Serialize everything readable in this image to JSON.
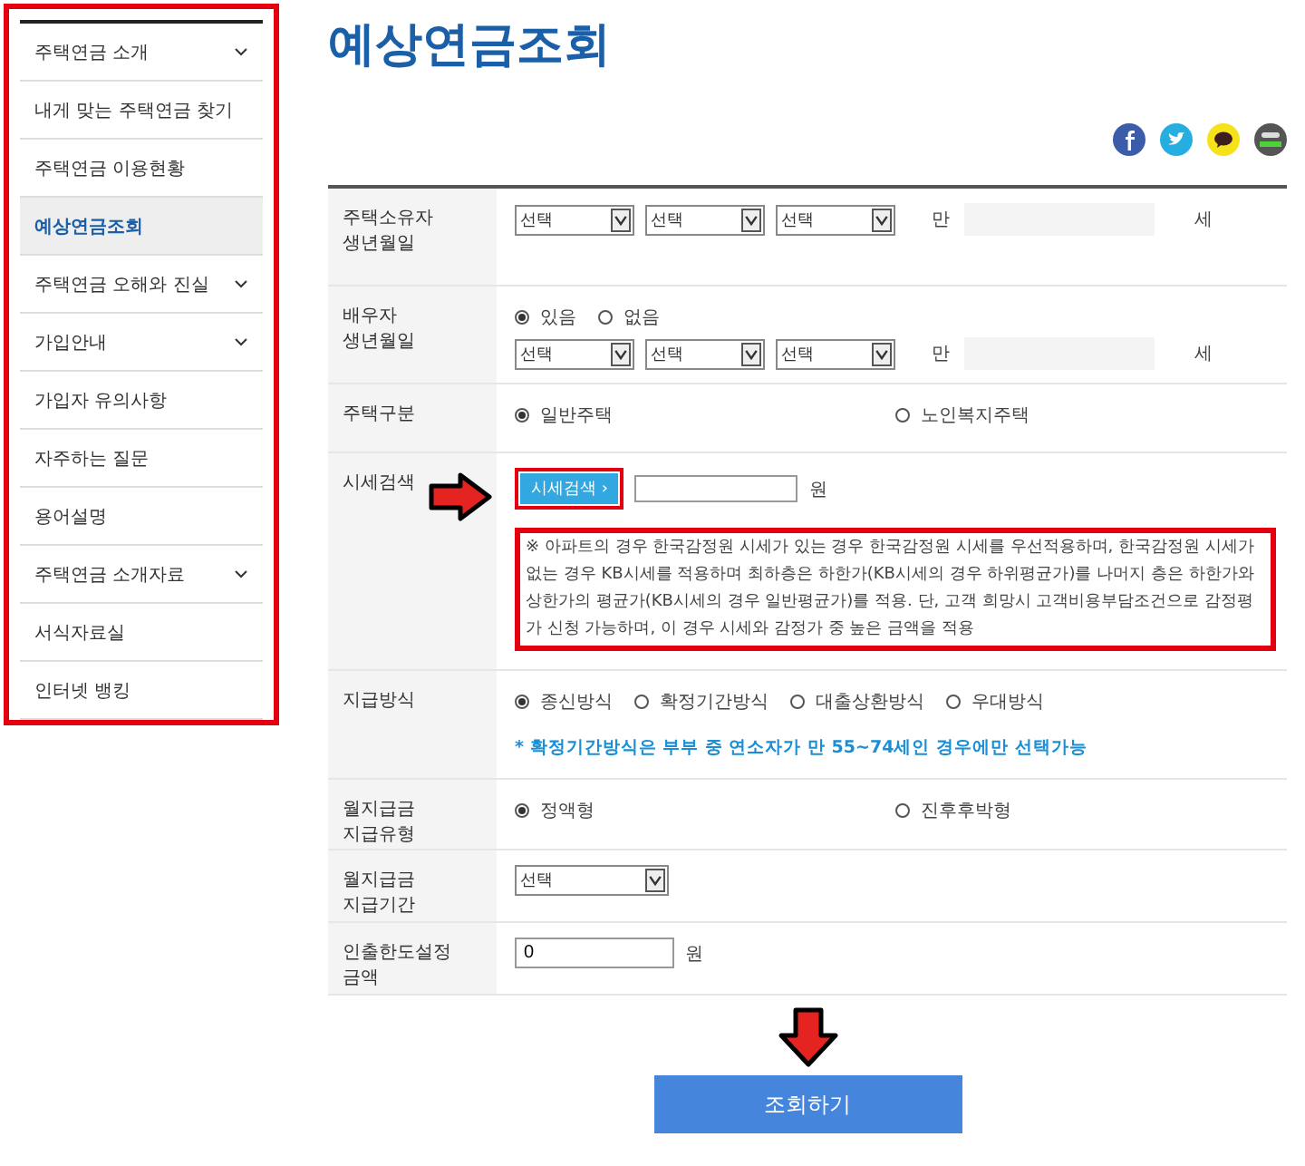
{
  "sidebar": {
    "highlighted": true,
    "items": [
      {
        "label": "주택연금 소개",
        "expandable": true,
        "selected": false
      },
      {
        "label": "내게 맞는 주택연금 찾기",
        "expandable": false,
        "selected": false
      },
      {
        "label": "주택연금 이용현황",
        "expandable": false,
        "selected": false
      },
      {
        "label": "예상연금조회",
        "expandable": false,
        "selected": true
      },
      {
        "label": "주택연금 오해와 진실",
        "expandable": true,
        "selected": false
      },
      {
        "label": "가입안내",
        "expandable": true,
        "selected": false
      },
      {
        "label": "가입자 유의사항",
        "expandable": false,
        "selected": false
      },
      {
        "label": "자주하는 질문",
        "expandable": false,
        "selected": false
      },
      {
        "label": "용어설명",
        "expandable": false,
        "selected": false
      },
      {
        "label": "주택연금 소개자료",
        "expandable": true,
        "selected": false
      },
      {
        "label": "서식자료실",
        "expandable": false,
        "selected": false
      },
      {
        "label": "인터넷 뱅킹",
        "expandable": false,
        "selected": false
      }
    ]
  },
  "title": "예상연금조회",
  "share_icons": [
    {
      "kind": "facebook",
      "color": "#3b5ca8"
    },
    {
      "kind": "twitter",
      "color": "#27aee0"
    },
    {
      "kind": "kakaotalk",
      "color": "#f6e21a"
    },
    {
      "kind": "band",
      "color": "#555555"
    }
  ],
  "form": {
    "rows": [
      {
        "kind": "birth",
        "label": [
          "주택소유자",
          "생년월일"
        ],
        "selects": [
          "선택",
          "선택",
          "선택"
        ],
        "age_prefix": "만",
        "age_suffix": "세"
      },
      {
        "kind": "birth",
        "label": [
          "배우자",
          "생년월일"
        ],
        "radios": [
          {
            "label": "있음",
            "selected": true
          },
          {
            "label": "없음",
            "selected": false
          }
        ],
        "selects": [
          "선택",
          "선택",
          "선택"
        ],
        "age_prefix": "만",
        "age_suffix": "세"
      },
      {
        "kind": "radios",
        "label": [
          "주택구분"
        ],
        "radios": [
          {
            "label": "일반주택",
            "selected": true
          },
          {
            "label": "노인복지주택",
            "selected": false
          }
        ]
      },
      {
        "kind": "search",
        "label": [
          "시세검색"
        ],
        "button": "시세검색",
        "button_arrow": "›",
        "unit": "원",
        "highlighted": true,
        "notice": "※ 아파트의 경우 한국감정원 시세가 있는 경우 한국감정원 시세를 우선적용하며, 한국감정원 시세가 없는 경우 KB시세를 적용하며 최하층은 하한가(KB시세의 경우 하위평균가)를 나머지 층은 하한가와 상한가의 평균가(KB시세의 경우 일반평균가)를 적용. 단, 고객 희망시 고객비용부담조건으로 감정평가 신청 가능하며, 이 경우 시세와 감정가 중 높은 금액을 적용"
      },
      {
        "kind": "inline-radios",
        "label": [
          "지급방식"
        ],
        "radios": [
          {
            "label": "종신방식",
            "selected": true
          },
          {
            "label": "확정기간방식",
            "selected": false
          },
          {
            "label": "대출상환방식",
            "selected": false
          },
          {
            "label": "우대방식",
            "selected": false
          }
        ],
        "note": "* 확정기간방식은 부부 중 연소자가 만 55~74세인 경우에만 선택가능"
      },
      {
        "kind": "radios",
        "label": [
          "월지급금",
          "지급유형"
        ],
        "radios": [
          {
            "label": "정액형",
            "selected": true
          },
          {
            "label": "진후후박형",
            "selected": false
          }
        ]
      },
      {
        "kind": "select",
        "label": [
          "월지급금",
          "지급기간"
        ],
        "select": "선택"
      },
      {
        "kind": "amount",
        "label": [
          "인출한도설정",
          "금액"
        ],
        "value": "0",
        "unit": "원"
      }
    ]
  },
  "submit": "조회하기"
}
